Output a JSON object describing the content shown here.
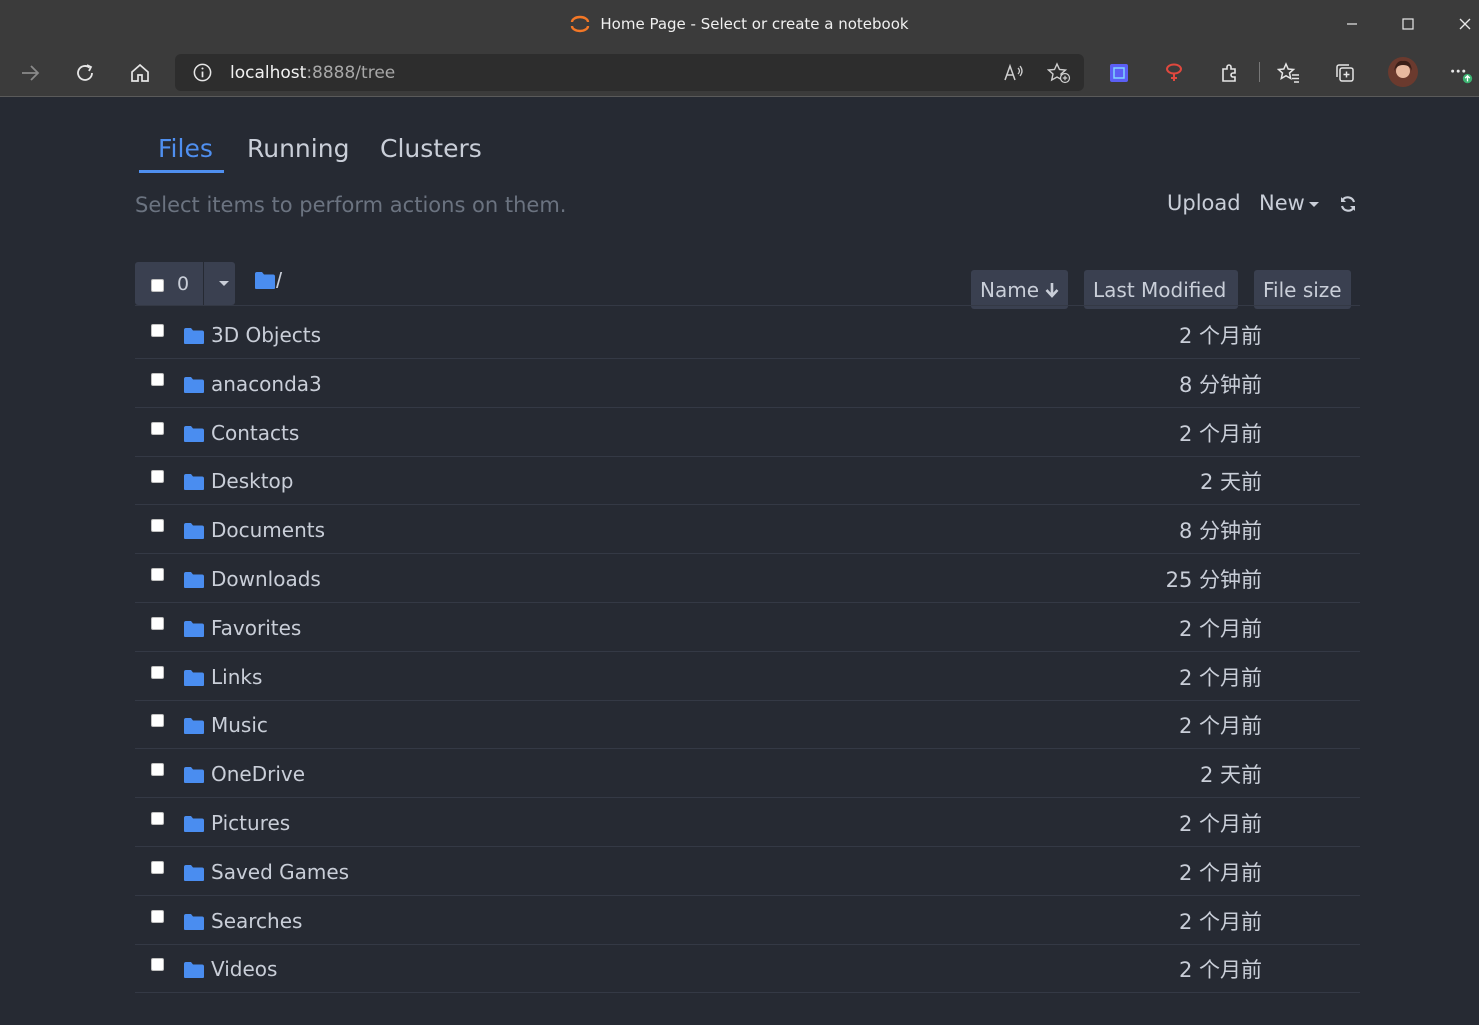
{
  "window": {
    "title": "Home Page - Select or create a notebook"
  },
  "browser": {
    "url_host": "localhost",
    "url_rest": ":8888/tree"
  },
  "tabs": [
    {
      "label": "Files",
      "active": true
    },
    {
      "label": "Running",
      "active": false
    },
    {
      "label": "Clusters",
      "active": false
    }
  ],
  "hint": "Select items to perform actions on them.",
  "actions": {
    "upload": "Upload",
    "new": "New"
  },
  "selection": {
    "count": "0"
  },
  "breadcrumb": "/",
  "sort": {
    "name": "Name",
    "last_modified": "Last Modified",
    "file_size": "File size"
  },
  "files": [
    {
      "name": "3D Objects",
      "modified": "2 个月前"
    },
    {
      "name": "anaconda3",
      "modified": "8 分钟前"
    },
    {
      "name": "Contacts",
      "modified": "2 个月前"
    },
    {
      "name": "Desktop",
      "modified": "2 天前"
    },
    {
      "name": "Documents",
      "modified": "8 分钟前"
    },
    {
      "name": "Downloads",
      "modified": "25 分钟前"
    },
    {
      "name": "Favorites",
      "modified": "2 个月前"
    },
    {
      "name": "Links",
      "modified": "2 个月前"
    },
    {
      "name": "Music",
      "modified": "2 个月前"
    },
    {
      "name": "OneDrive",
      "modified": "2 天前"
    },
    {
      "name": "Pictures",
      "modified": "2 个月前"
    },
    {
      "name": "Saved Games",
      "modified": "2 个月前"
    },
    {
      "name": "Searches",
      "modified": "2 个月前"
    },
    {
      "name": "Videos",
      "modified": "2 个月前"
    }
  ],
  "colors": {
    "background": "#262a33",
    "accent": "#4f8ff0",
    "folder": "#4a8df0",
    "button_bg": "#3a4050"
  },
  "icons": [
    "jupyter-logo-icon",
    "forward-icon",
    "reload-icon",
    "home-icon",
    "info-icon",
    "read-aloud-icon",
    "favorite-add-icon",
    "extension-icon",
    "favorites-icon",
    "collections-icon",
    "profile-avatar",
    "more-icon",
    "folder-icon",
    "refresh-icon",
    "arrow-down-icon"
  ]
}
